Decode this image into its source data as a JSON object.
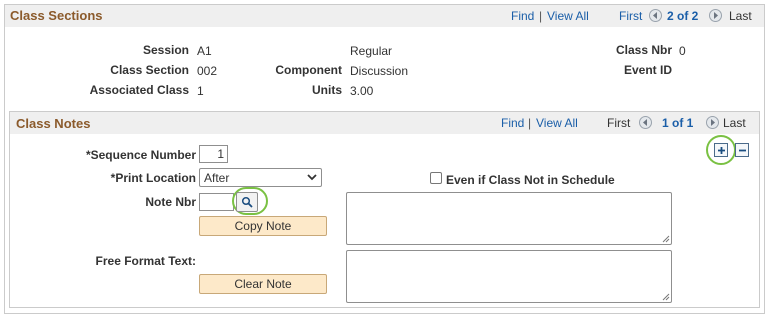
{
  "class_sections": {
    "title": "Class Sections",
    "find": "Find",
    "sep": "|",
    "view_all": "View All",
    "first": "First",
    "page": "2 of 2",
    "last": "Last",
    "fields": {
      "session_label": "Session",
      "session_value": "A1",
      "session_type": "Regular",
      "class_nbr_label": "Class Nbr",
      "class_nbr_value": "0",
      "class_section_label": "Class Section",
      "class_section_value": "002",
      "component_label": "Component",
      "component_value": "Discussion",
      "event_id_label": "Event ID",
      "associated_class_label": "Associated Class",
      "associated_class_value": "1",
      "units_label": "Units",
      "units_value": "3.00"
    }
  },
  "class_notes": {
    "title": "Class Notes",
    "find": "Find",
    "sep": "|",
    "view_all": "View All",
    "first": "First",
    "page": "1 of 1",
    "last": "Last",
    "sequence_number_label": "*Sequence Number",
    "sequence_number_value": "1",
    "print_location_label": "*Print Location",
    "print_location_value": "After",
    "even_if_label": "Even if Class Not in Schedule",
    "note_nbr_label": "Note Nbr",
    "note_nbr_value": "",
    "copy_note_label": "Copy Note",
    "free_format_label": "Free Format Text:",
    "clear_note_label": "Clear Note"
  },
  "colors": {
    "header_title": "#8b5a2b",
    "link": "#1a5ea8",
    "highlight_ring": "#7ac143",
    "button_bg": "#fde9c9"
  }
}
